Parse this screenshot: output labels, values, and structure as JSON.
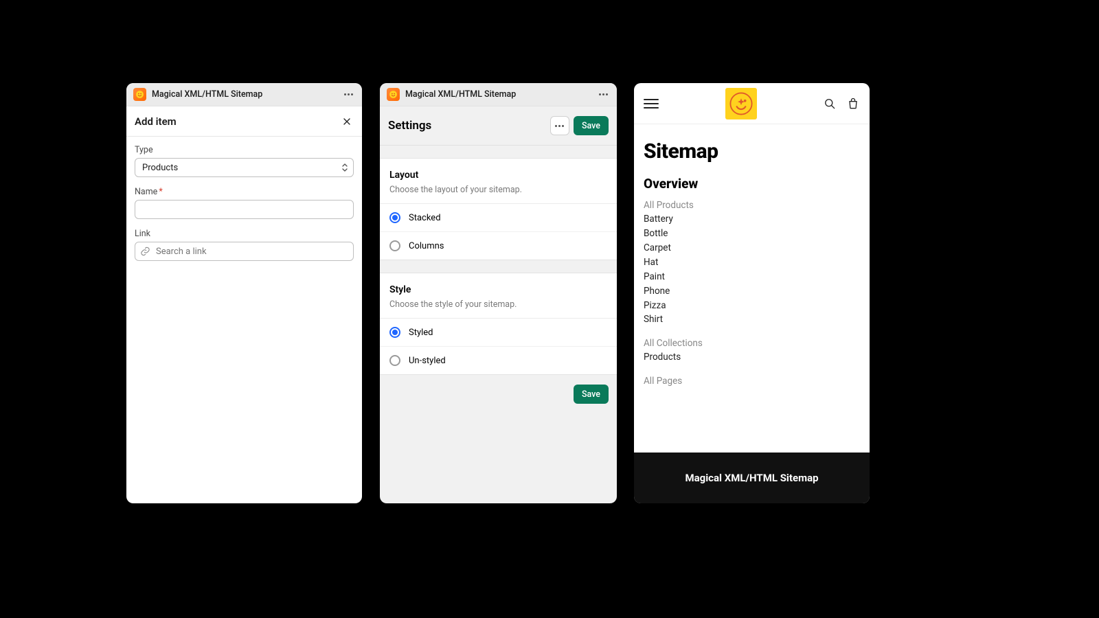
{
  "panel1": {
    "app_title": "Magical XML/HTML Sitemap",
    "heading": "Add item",
    "type_label": "Type",
    "type_value": "Products",
    "name_label": "Name",
    "link_label": "Link",
    "link_placeholder": "Search a link"
  },
  "panel2": {
    "app_title": "Magical XML/HTML Sitemap",
    "heading": "Settings",
    "save_label": "Save",
    "layout": {
      "title": "Layout",
      "desc": "Choose the layout of your sitemap.",
      "opt1": "Stacked",
      "opt2": "Columns"
    },
    "style": {
      "title": "Style",
      "desc": "Choose the style of your sitemap.",
      "opt1": "Styled",
      "opt2": "Un-styled"
    },
    "footer_save": "Save"
  },
  "panel3": {
    "title": "Sitemap",
    "overview": "Overview",
    "all_products": "All Products",
    "p1": "Battery",
    "p2": "Bottle",
    "p3": "Carpet",
    "p4": "Hat",
    "p5": "Paint",
    "p6": "Phone",
    "p7": "Pizza",
    "p8": "Shirt",
    "all_collections": "All Collections",
    "c1": "Products",
    "all_pages": "All Pages",
    "footer": "Magical XML/HTML Sitemap"
  }
}
